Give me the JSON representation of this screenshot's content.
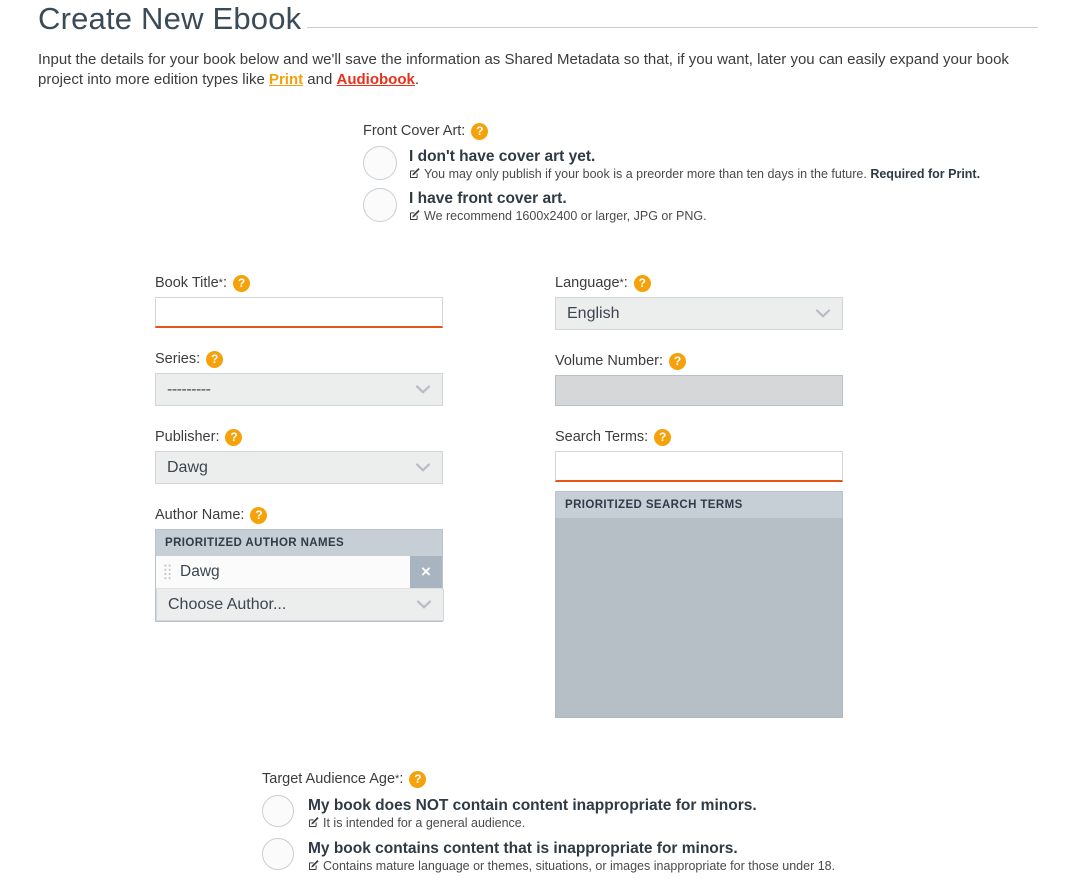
{
  "page": {
    "title": "Create New Ebook",
    "intro_1": "Input the details for your book below and we'll save the information as Shared Metadata so that, if you want, later you can easily expand your book project into more edition types like ",
    "intro_link_print": "Print",
    "intro_mid": " and ",
    "intro_link_audiobook": "Audiobook",
    "intro_end": "."
  },
  "colors": {
    "accent_orange": "#f5a10a",
    "link_print": "#f5a10a",
    "link_audiobook": "#e8311a",
    "required_underline": "#e8531a",
    "header_band": "#c6ced6",
    "list_box": "#b6bfc6",
    "delete_button": "#a8b4bf",
    "title_text": "#3b4a57"
  },
  "help_icon": {
    "glyph": "?",
    "name": "help-icon"
  },
  "cover_art": {
    "label": "Front Cover Art:",
    "options": [
      {
        "title": "I don't have cover art yet.",
        "sub_a": "You may only publish if your book is a preorder more than ten days in the future. ",
        "sub_b": "Required for Print.",
        "selected": false
      },
      {
        "title": "I have front cover art.",
        "sub_a": "We recommend 1600x2400 or larger, JPG or PNG.",
        "sub_b": "",
        "selected": false
      }
    ]
  },
  "left_column": {
    "book_title": {
      "label": "Book Title",
      "required_mark": "*",
      "colon": ":",
      "value": "",
      "placeholder": ""
    },
    "series": {
      "label": "Series:",
      "value": "---------",
      "options": [
        "---------"
      ]
    },
    "publisher": {
      "label": "Publisher:",
      "value": "Dawg",
      "options": [
        "Dawg"
      ]
    },
    "author_name": {
      "label": "Author Name:",
      "list_header": "PRIORITIZED AUTHOR NAMES",
      "entries": [
        "Dawg"
      ],
      "delete_glyph": "×",
      "chooser_value": "Choose Author...",
      "chooser_options": [
        "Choose Author..."
      ]
    }
  },
  "right_column": {
    "language": {
      "label": "Language",
      "required_mark": "*",
      "colon": ":",
      "value": "English",
      "options": [
        "English"
      ]
    },
    "volume_number": {
      "label": "Volume Number:",
      "value": "",
      "placeholder": "",
      "disabled": true
    },
    "search_terms": {
      "label": "Search Terms:",
      "value": "",
      "placeholder": "",
      "list_header": "PRIORITIZED SEARCH TERMS",
      "entries": []
    }
  },
  "audience": {
    "label": "Target Audience Age",
    "required_mark": "*",
    "colon": ":",
    "options": [
      {
        "title": "My book does NOT contain content inappropriate for minors.",
        "sub": "It is intended for a general audience.",
        "selected": false
      },
      {
        "title": "My book contains content that is inappropriate for minors.",
        "sub": "Contains mature language or themes, situations, or images inappropriate for those under 18.",
        "selected": false
      }
    ]
  }
}
